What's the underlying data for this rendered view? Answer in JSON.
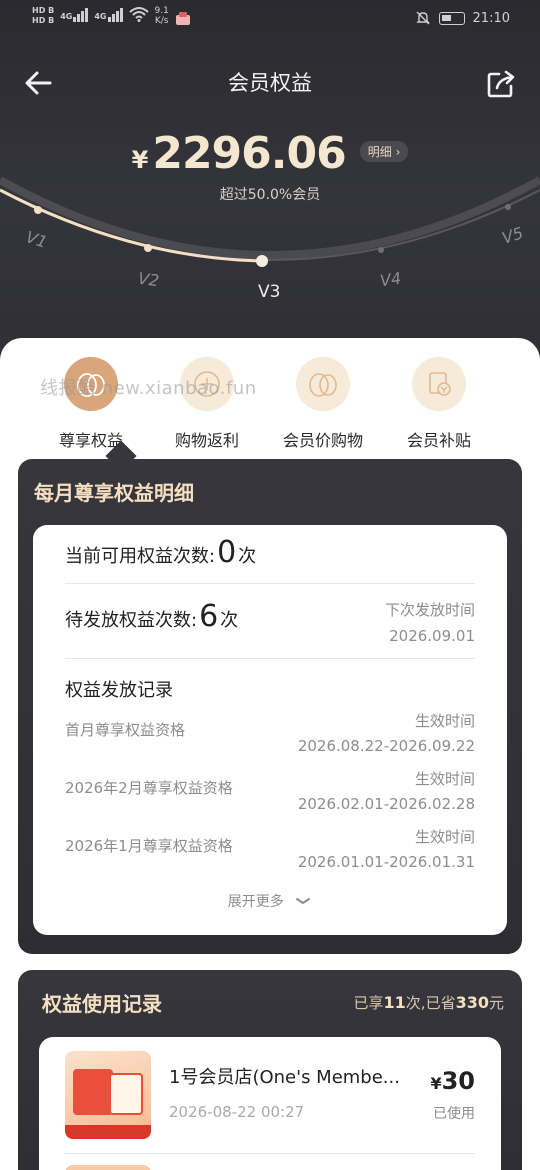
{
  "status_bar": {
    "hd_top": "HD B",
    "hd_bottom": "HD B",
    "net1": "4G",
    "net2": "4G",
    "speed_value": "9.1",
    "speed_unit": "K/s",
    "time": "21:10"
  },
  "nav": {
    "title": "会员权益"
  },
  "savings": {
    "currency": "¥",
    "amount": "2296.06",
    "detail_label": "明细",
    "exceed_text": "超过50.0%会员"
  },
  "levels": {
    "items": [
      "V1",
      "V2",
      "V3",
      "V4",
      "V5"
    ],
    "current": "V3"
  },
  "watermark": "线报酷 new.xianbao.fun",
  "tabs": [
    {
      "label": "尊享权益",
      "icon": "egg-icon",
      "active": true
    },
    {
      "label": "购物返利",
      "icon": "rebate-icon",
      "active": false
    },
    {
      "label": "会员价购物",
      "icon": "egg-icon",
      "active": false
    },
    {
      "label": "会员补贴",
      "icon": "subsidy-icon",
      "active": false
    }
  ],
  "monthly": {
    "title": "每月尊享权益明细",
    "available_label": "当前可用权益次数:",
    "available_count": "0",
    "available_unit": "次",
    "pending_label": "待发放权益次数:",
    "pending_count": "6",
    "pending_unit": "次",
    "next_time_label": "下次发放时间",
    "next_time_value": "2026.09.01",
    "records_title": "权益发放记录",
    "records": [
      {
        "name": "首月尊享权益资格",
        "label": "生效时间",
        "range": "2026.08.22-2026.09.22"
      },
      {
        "name": "2026年2月尊享权益资格",
        "label": "生效时间",
        "range": "2026.02.01-2026.02.28"
      },
      {
        "name": "2026年1月尊享权益资格",
        "label": "生效时间",
        "range": "2026.01.01-2026.01.31"
      }
    ],
    "expand_label": "展开更多"
  },
  "usage": {
    "title": "权益使用记录",
    "summary_prefix": "已享",
    "summary_times": "11",
    "summary_mid": "次,已省",
    "summary_amount": "330",
    "summary_suffix": "元",
    "items": [
      {
        "name": "1号会员店(One's Membe...",
        "time": "2026-08-22 00:27",
        "currency": "¥",
        "price": "30",
        "status": "已使用"
      }
    ]
  },
  "colors": {
    "gold": "#f4dfc0",
    "dark_bg": "#2b2b30",
    "active_tab": "#d9a57a"
  }
}
